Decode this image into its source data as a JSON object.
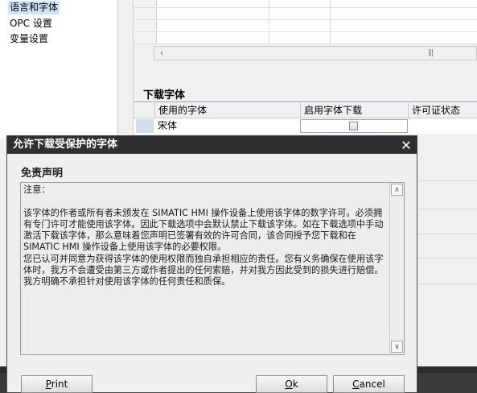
{
  "tree": {
    "items": [
      {
        "label": "语言和字体",
        "selected": true
      },
      {
        "label": "OPC 设置",
        "selected": false
      },
      {
        "label": "变量设置",
        "selected": false
      }
    ]
  },
  "download_fonts": {
    "title": "下载字体",
    "columns": [
      "使用的字体",
      "启用字体下载",
      "许可证状态"
    ],
    "rows": [
      {
        "font": "宋体",
        "download_enabled": false,
        "license_status": ""
      }
    ]
  },
  "dialog": {
    "title": "允许下载受保护的字体",
    "heading": "免责声明",
    "text": "注意：\n\n该字体的作者或所有者未颁发在 SIMATIC HMI 操作设备上使用该字体的数字许可。必须拥有专门许可才能使用该字体。因此下载选项中会默认禁止下载该字体。如在下载选项中手动激活下载该字体，那么意味着您声明已签署有效的许可合同，该合同授予您下载和在 SIMATIC HMI 操作设备上使用该字体的必要权限。\n您已认可并同意为获得该字体的使用权限而独自承担相应的责任。您有义务确保在使用该字体时，我方不会遭受由第三方或作者提出的任何索赔，并对我方因此受到的损失进行赔偿。我方明确不承担针对使用该字体的任何责任和质保。",
    "buttons": {
      "print": {
        "pre": "",
        "accel": "P",
        "post": "rint"
      },
      "ok": {
        "pre": "",
        "accel": "O",
        "post": "k"
      },
      "cancel": {
        "pre": "",
        "accel": "C",
        "post": "ancel"
      }
    }
  },
  "icons": {
    "close": "✕",
    "scroll_left": "‹",
    "scroll_up": "∧",
    "scroll_down": "∨",
    "scroll_grip": "|||"
  },
  "colors": {
    "titlebar": "#2f3033",
    "selection": "#cde6f7",
    "row_header": "#cfdfec"
  }
}
